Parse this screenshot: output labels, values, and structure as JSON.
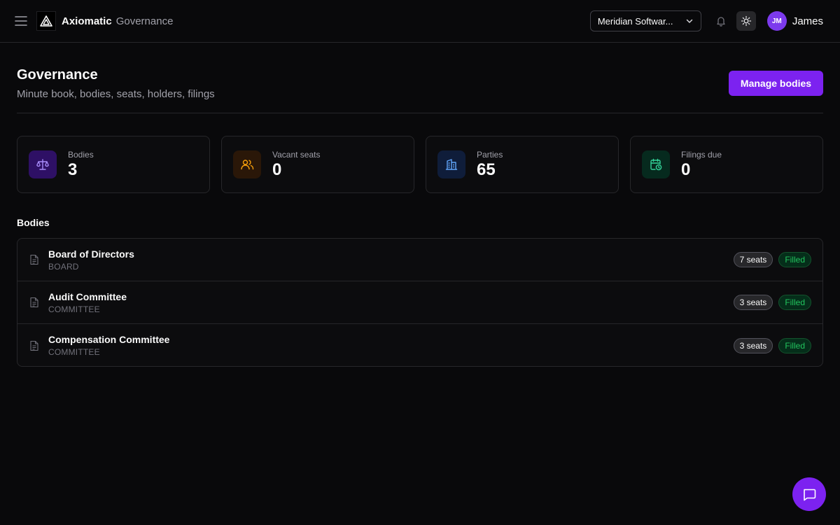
{
  "header": {
    "brand": "Axiomatic",
    "brand_sub": "Governance",
    "org_selector": "Meridian Softwar...",
    "user_initials": "JM",
    "user_name": "James"
  },
  "page": {
    "title": "Governance",
    "subtitle": "Minute book, bodies, seats, holders, filings",
    "primary_action": "Manage bodies"
  },
  "stats": [
    {
      "label": "Bodies",
      "value": "3",
      "icon": "scale-icon",
      "color": "#a78bfa"
    },
    {
      "label": "Vacant seats",
      "value": "0",
      "icon": "users-icon",
      "color": "#f59e0b"
    },
    {
      "label": "Parties",
      "value": "65",
      "icon": "building-icon",
      "color": "#60a5fa"
    },
    {
      "label": "Filings due",
      "value": "0",
      "icon": "calendar-clock-icon",
      "color": "#34d399"
    }
  ],
  "bodies": {
    "section_title": "Bodies",
    "items": [
      {
        "name": "Board of Directors",
        "type": "BOARD",
        "seats": "7 seats",
        "status": "Filled"
      },
      {
        "name": "Audit Committee",
        "type": "COMMITTEE",
        "seats": "3 seats",
        "status": "Filled"
      },
      {
        "name": "Compensation Committee",
        "type": "COMMITTEE",
        "seats": "3 seats",
        "status": "Filled"
      }
    ]
  },
  "colors": {
    "accent": "#7c22f0",
    "background": "#09090b",
    "status_green": "#22c55e"
  }
}
